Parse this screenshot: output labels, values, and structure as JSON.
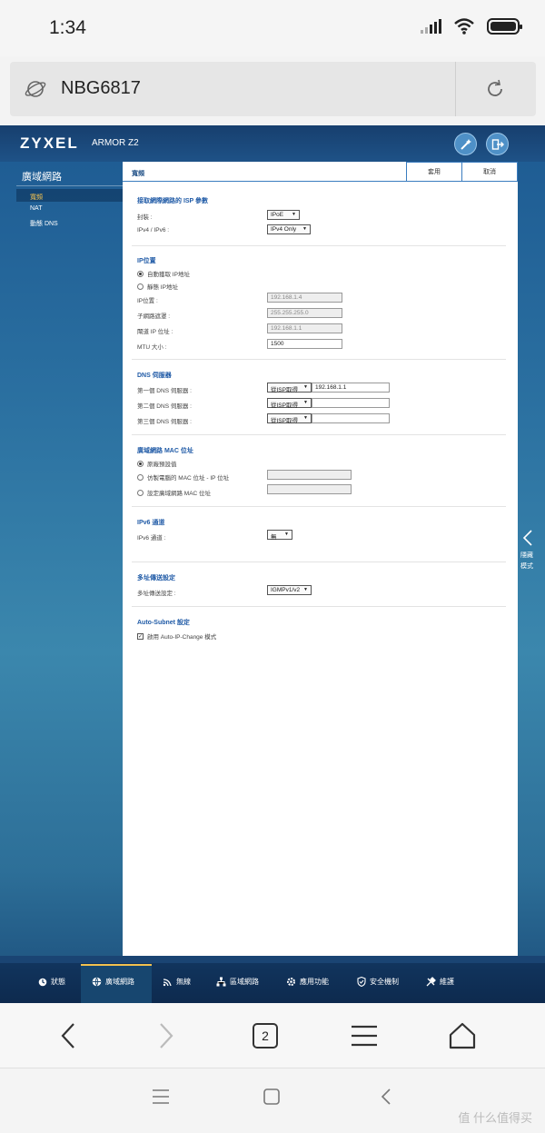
{
  "status_bar": {
    "time": "1:34"
  },
  "address_bar": {
    "url": "NBG6817"
  },
  "router": {
    "brand": "ZYXEL",
    "model": "ARMOR Z2",
    "sidebar": {
      "title": "廣域網路",
      "items": [
        {
          "label": "寬頻",
          "active": true
        },
        {
          "label": "NAT",
          "active": false
        },
        {
          "label": "動態 DNS",
          "active": false
        }
      ]
    },
    "panel": {
      "title": "寬頻",
      "apply_label": "套用",
      "cancel_label": "取消",
      "isp": {
        "title": "接取網際網路的 ISP 參數",
        "encapsulation_label": "封裝 :",
        "encapsulation_value": "IPoE",
        "ipver_label": "IPv4 / IPv6 :",
        "ipver_value": "IPv4 Only"
      },
      "ip": {
        "title": "IP位置",
        "auto_label": "自動獲取 IP地址",
        "static_label": "靜態 IP地址",
        "ip_label": "IP位置 :",
        "ip_value": "192.168.1.4",
        "mask_label": "子網路遮罩 :",
        "mask_value": "255.255.255.0",
        "gw_label": "閘道 IP 位址 :",
        "gw_value": "192.168.1.1",
        "mtu_label": "MTU 大小 :",
        "mtu_value": "1500"
      },
      "dns": {
        "title": "DNS 伺服器",
        "rows": [
          {
            "label": "第一個 DNS 伺服器 :",
            "mode": "從ISP取得",
            "value": "192.168.1.1"
          },
          {
            "label": "第二個 DNS 伺服器 :",
            "mode": "從ISP取得",
            "value": ""
          },
          {
            "label": "第三個 DNS 伺服器 :",
            "mode": "從ISP取得",
            "value": ""
          }
        ]
      },
      "mac": {
        "title": "廣域網路 MAC 位址",
        "default_label": "原廠預設值",
        "clone_label": "仿製電腦的 MAC 位址 - IP 位址",
        "set_label": "設定廣域網路 MAC 位址"
      },
      "ipv6": {
        "title": "IPv6 通道",
        "label": "IPv6 通道 :",
        "value": "無"
      },
      "multicast": {
        "title": "多址傳送設定",
        "label": "多址傳送設定 :",
        "value": "IGMPv1/v2"
      },
      "auto_subnet": {
        "title": "Auto-Subnet 設定",
        "enable_label": "啟用 Auto-IP-Change 模式"
      }
    },
    "right_tab": {
      "line1": "隱藏",
      "line2": "模式"
    },
    "bottom_nav": [
      {
        "label": "狀態",
        "icon": "status-icon"
      },
      {
        "label": "廣域網路",
        "icon": "globe-icon",
        "active": true
      },
      {
        "label": "無線",
        "icon": "wifi-icon"
      },
      {
        "label": "區域網路",
        "icon": "network-icon"
      },
      {
        "label": "應用功能",
        "icon": "gear-icon"
      },
      {
        "label": "安全機制",
        "icon": "shield-icon"
      },
      {
        "label": "維護",
        "icon": "tools-icon"
      }
    ]
  },
  "browser_toolbar": {
    "tab_count": "2"
  },
  "watermark": "值 什么值得买"
}
